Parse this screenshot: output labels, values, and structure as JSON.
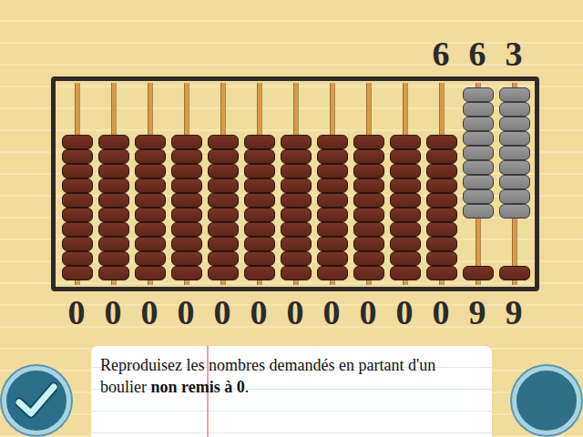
{
  "target": [
    "",
    "",
    "",
    "",
    "",
    "",
    "",
    "",
    "",
    "",
    "6",
    "6",
    "3"
  ],
  "rods": [
    {
      "value": "0",
      "raised": 0
    },
    {
      "value": "0",
      "raised": 0
    },
    {
      "value": "0",
      "raised": 0
    },
    {
      "value": "0",
      "raised": 0
    },
    {
      "value": "0",
      "raised": 0
    },
    {
      "value": "0",
      "raised": 0
    },
    {
      "value": "0",
      "raised": 0
    },
    {
      "value": "0",
      "raised": 0
    },
    {
      "value": "0",
      "raised": 0
    },
    {
      "value": "0",
      "raised": 0
    },
    {
      "value": "0",
      "raised": 0
    },
    {
      "value": "9",
      "raised": 9
    },
    {
      "value": "9",
      "raised": 9
    }
  ],
  "instruction": [
    {
      "text": "Reproduisez les nombres demandés en partant d'un boulier ",
      "bold": false
    },
    {
      "text": "non remis à 0",
      "bold": true
    },
    {
      "text": ".",
      "bold": false
    }
  ],
  "buttons": [
    {
      "kind": "check"
    },
    {
      "kind": "plain"
    }
  ]
}
